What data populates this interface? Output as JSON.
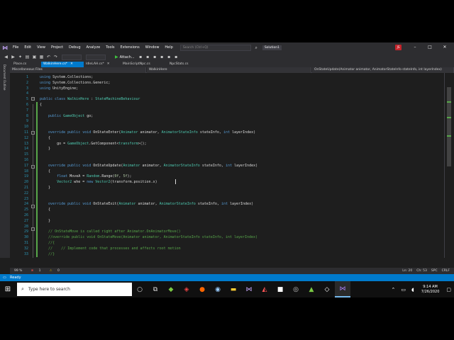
{
  "menu": {
    "logo_icon": "visual-studio-icon",
    "items": [
      "File",
      "Edit",
      "View",
      "Project",
      "Debug",
      "Analyze",
      "Tools",
      "Extensions",
      "Window",
      "Help"
    ],
    "search_placeholder": "Search (Ctrl+Q)",
    "solution": "Solution1",
    "user_initials": "JS"
  },
  "toolbar": {
    "attach_label": "Attach..."
  },
  "side_panel": {
    "label": "Document Outline"
  },
  "tabs": [
    {
      "label": "Place.cs"
    },
    {
      "label": "WalkinHere.cs*",
      "active": true
    },
    {
      "label": "IdleLAH.cs*"
    },
    {
      "label": "MainScriptNpc.cs"
    },
    {
      "label": "NpcStats.cs"
    }
  ],
  "navbar": {
    "project": "Miscellaneous Files",
    "class": "WalkinHere",
    "member": "OnStateUpdate(Animator animator, AnimatorStateInfo stateInfo, int layerIndex)"
  },
  "code_lines": [
    {
      "n": "1",
      "html": "<span class='kw'>using</span> System.Collections;"
    },
    {
      "n": "2",
      "html": "<span class='kw'>using</span> System.Collections.Generic;"
    },
    {
      "n": "3",
      "html": "<span class='kw'>using</span> UnityEngine;"
    },
    {
      "n": "4",
      "html": ""
    },
    {
      "n": "5",
      "html": "<span class='kw'>public class</span> <span class='ty'>WalkinHere</span> : <span class='ty'>StateMachineBehaviour</span>"
    },
    {
      "n": "6",
      "html": "{"
    },
    {
      "n": "7",
      "html": ""
    },
    {
      "n": "8",
      "html": "    <span class='kw'>public</span> <span class='ty'>GameObject</span> go;"
    },
    {
      "n": "9",
      "html": ""
    },
    {
      "n": "10",
      "html": ""
    },
    {
      "n": "11",
      "html": "    <span class='kw'>override public void</span> OnStateEnter(<span class='ty'>Animator</span> animator, <span class='ty'>AnimatorStateInfo</span> stateInfo, <span class='kw'>int</span> layerIndex)"
    },
    {
      "n": "12",
      "html": "    {"
    },
    {
      "n": "13",
      "html": "        go = <span class='ty'>GameObject</span>.GetComponent&lt;<span class='ty'>transform</span>&gt;();"
    },
    {
      "n": "14",
      "html": "    }"
    },
    {
      "n": "15",
      "html": ""
    },
    {
      "n": "16",
      "html": ""
    },
    {
      "n": "17",
      "html": "    <span class='kw'>override public void</span> OnStateUpdate(<span class='ty'>Animator</span> animator, <span class='ty'>AnimatorStateInfo</span> stateInfo, <span class='kw'>int</span> layerIndex)"
    },
    {
      "n": "18",
      "html": "    {"
    },
    {
      "n": "19",
      "html": "        <span class='kw'>float</span> MoveA = <span class='ty'>Random</span>.Range(<span class='nu'>0f</span>, <span class='nu'>5f</span>);"
    },
    {
      "n": "20",
      "html": "        <span class='ty'>Vector2</span> whe = <span class='kw'>new</span> <span class='ty'>Vector2</span>(transform.position.x)"
    },
    {
      "n": "21",
      "html": "    }"
    },
    {
      "n": "22",
      "html": ""
    },
    {
      "n": "23",
      "html": ""
    },
    {
      "n": "24",
      "html": "    <span class='kw'>override public void</span> OnStateExit(<span class='ty'>Animator</span> animator, <span class='ty'>AnimatorStateInfo</span> stateInfo, <span class='kw'>int</span> layerIndex)"
    },
    {
      "n": "25",
      "html": "    {"
    },
    {
      "n": "26",
      "html": ""
    },
    {
      "n": "27",
      "html": "    }"
    },
    {
      "n": "28",
      "html": ""
    },
    {
      "n": "29",
      "html": "    <span class='cm'>// OnStateMove is called right after Animator.OnAnimatorMove()</span>"
    },
    {
      "n": "30",
      "html": "    <span class='cm'>//override public void OnStateMove(Animator animator, AnimatorStateInfo stateInfo, int layerIndex)</span>"
    },
    {
      "n": "31",
      "html": "    <span class='cm'>//{</span>"
    },
    {
      "n": "32",
      "html": "    <span class='cm'>//    // Implement code that processes and affects root motion</span>"
    },
    {
      "n": "33",
      "html": "    <span class='cm'>//}</span>"
    }
  ],
  "editor_status": {
    "zoom": "99 %",
    "errors": "1",
    "warnings": "0",
    "line": "Ln: 20",
    "col": "Ch: 53",
    "spacing": "SPC",
    "eol": "CRLF"
  },
  "statusbar": {
    "text": "Ready"
  },
  "taskbar": {
    "search_placeholder": "Type here to search",
    "time": "9:14 AM",
    "date": "7/26/2020"
  }
}
